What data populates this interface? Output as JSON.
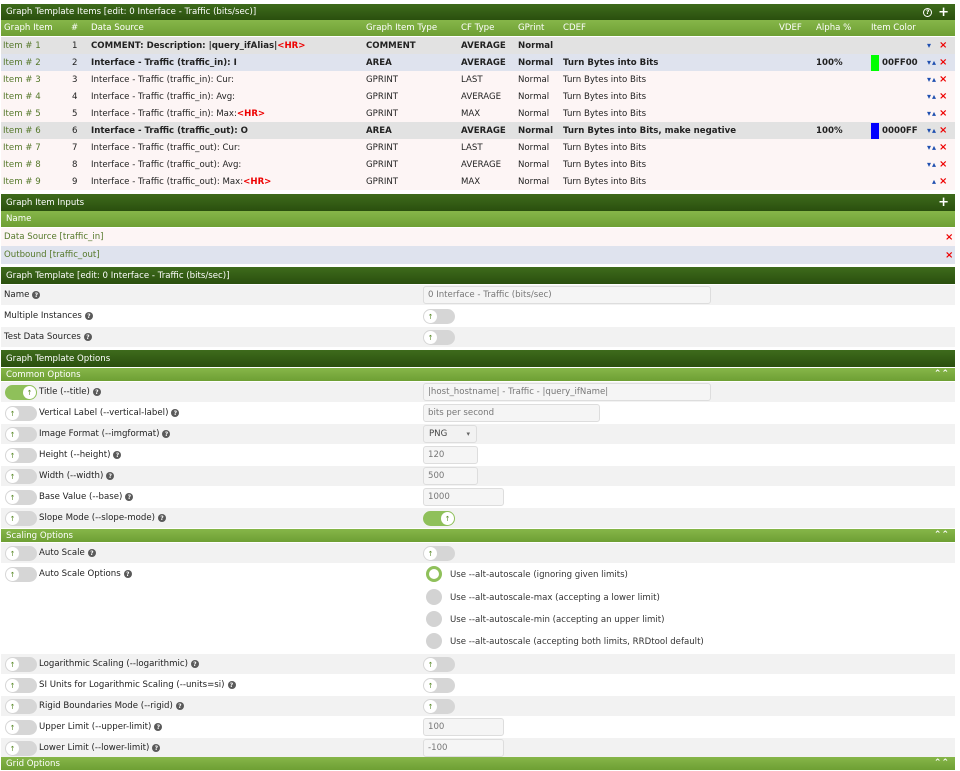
{
  "items_section": {
    "title": "Graph Template Items [edit: 0 Interface - Traffic (bits/sec)]",
    "columns": [
      "Graph Item",
      "#",
      "Data Source",
      "Graph Item Type",
      "CF Type",
      "GPrint",
      "CDEF",
      "VDEF",
      "Alpha %",
      "Item Color"
    ],
    "rows": [
      {
        "item": "Item # 1",
        "num": "1",
        "source": "COMMENT: Description: |query_ifAlias|",
        "hr": "<HR>",
        "type": "COMMENT",
        "cf": "AVERAGE",
        "gprint": "Normal",
        "cdef": "",
        "alpha": "",
        "color_hex": "",
        "color_text": ""
      },
      {
        "item": "Item # 2",
        "num": "2",
        "source": "Interface - Traffic (traffic_in): I",
        "hr": "",
        "type": "AREA",
        "cf": "AVERAGE",
        "gprint": "Normal",
        "cdef": "Turn Bytes into Bits",
        "alpha": "100%",
        "color_hex": "#00FF00",
        "color_text": "00FF00"
      },
      {
        "item": "Item # 3",
        "num": "3",
        "source": "Interface - Traffic (traffic_in): Cur:",
        "hr": "",
        "type": "GPRINT",
        "cf": "LAST",
        "gprint": "Normal",
        "cdef": "Turn Bytes into Bits",
        "alpha": "",
        "color_hex": "",
        "color_text": ""
      },
      {
        "item": "Item # 4",
        "num": "4",
        "source": "Interface - Traffic (traffic_in): Avg:",
        "hr": "",
        "type": "GPRINT",
        "cf": "AVERAGE",
        "gprint": "Normal",
        "cdef": "Turn Bytes into Bits",
        "alpha": "",
        "color_hex": "",
        "color_text": ""
      },
      {
        "item": "Item # 5",
        "num": "5",
        "source": "Interface - Traffic (traffic_in): Max:",
        "hr": "<HR>",
        "type": "GPRINT",
        "cf": "MAX",
        "gprint": "Normal",
        "cdef": "Turn Bytes into Bits",
        "alpha": "",
        "color_hex": "",
        "color_text": ""
      },
      {
        "item": "Item # 6",
        "num": "6",
        "source": "Interface - Traffic (traffic_out): O",
        "hr": "",
        "type": "AREA",
        "cf": "AVERAGE",
        "gprint": "Normal",
        "cdef": "Turn Bytes into Bits, make negative",
        "alpha": "100%",
        "color_hex": "#0000FF",
        "color_text": "0000FF"
      },
      {
        "item": "Item # 7",
        "num": "7",
        "source": "Interface - Traffic (traffic_out): Cur:",
        "hr": "",
        "type": "GPRINT",
        "cf": "LAST",
        "gprint": "Normal",
        "cdef": "Turn Bytes into Bits",
        "alpha": "",
        "color_hex": "",
        "color_text": ""
      },
      {
        "item": "Item # 8",
        "num": "8",
        "source": "Interface - Traffic (traffic_out): Avg:",
        "hr": "",
        "type": "GPRINT",
        "cf": "AVERAGE",
        "gprint": "Normal",
        "cdef": "Turn Bytes into Bits",
        "alpha": "",
        "color_hex": "",
        "color_text": ""
      },
      {
        "item": "Item # 9",
        "num": "9",
        "source": "Interface - Traffic (traffic_out): Max:",
        "hr": "<HR>",
        "type": "GPRINT",
        "cf": "MAX",
        "gprint": "Normal",
        "cdef": "Turn Bytes into Bits",
        "alpha": "",
        "color_hex": "",
        "color_text": ""
      }
    ]
  },
  "inputs_section": {
    "title": "Graph Item Inputs",
    "column": "Name",
    "rows": [
      "Data Source [traffic_in]",
      "Outbound [traffic_out]"
    ]
  },
  "template_section": {
    "title": "Graph Template [edit: 0 Interface - Traffic (bits/sec)]",
    "name_label": "Name",
    "name_value": "0 Interface - Traffic (bits/sec)",
    "multi_label": "Multiple Instances",
    "test_label": "Test Data Sources"
  },
  "options_section": {
    "title": "Graph Template Options",
    "common": {
      "title": "Common Options",
      "title_label": "Title (--title)",
      "title_value": "|host_hostname| - Traffic - |query_ifName|",
      "vlabel_label": "Vertical Label (--vertical-label)",
      "vlabel_value": "bits per second",
      "imgformat_label": "Image Format (--imgformat)",
      "imgformat_value": "PNG",
      "height_label": "Height (--height)",
      "height_value": "120",
      "width_label": "Width (--width)",
      "width_value": "500",
      "base_label": "Base Value (--base)",
      "base_value": "1000",
      "slope_label": "Slope Mode (--slope-mode)"
    },
    "scaling": {
      "title": "Scaling Options",
      "autoscale_label": "Auto Scale",
      "autoscale_opts_label": "Auto Scale Options",
      "radio_options": [
        "Use --alt-autoscale (ignoring given limits)",
        "Use --alt-autoscale-max (accepting a lower limit)",
        "Use --alt-autoscale-min (accepting an upper limit)",
        "Use --alt-autoscale (accepting both limits, RRDtool default)"
      ],
      "log_label": "Logarithmic Scaling (--logarithmic)",
      "si_label": "SI Units for Logarithmic Scaling (--units=si)",
      "rigid_label": "Rigid Boundaries Mode (--rigid)",
      "upper_label": "Upper Limit (--upper-limit)",
      "upper_value": "100",
      "lower_label": "Lower Limit (--lower-limit)",
      "lower_value": "-100"
    },
    "grid": {
      "title": "Grid Options"
    }
  },
  "icons": {
    "help": "?",
    "plus": "+",
    "collapse": "⌃⌃",
    "delete": "×",
    "move_down": "▾",
    "move_up": "▴",
    "toggle_knob": "↑",
    "select_caret": "▾"
  }
}
